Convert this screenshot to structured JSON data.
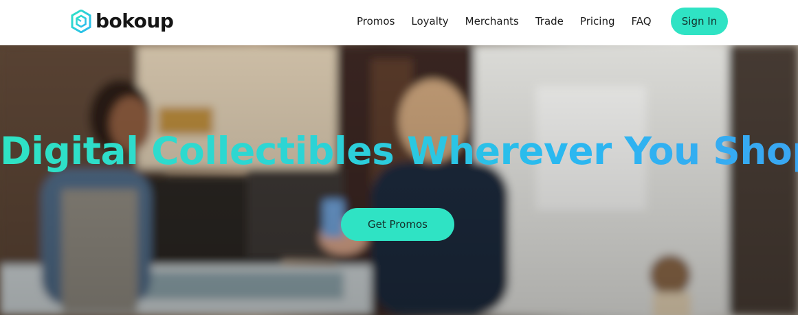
{
  "brand": {
    "name": "bokoup",
    "logo_icon": "hexagon-cube-icon"
  },
  "nav": {
    "items": [
      {
        "label": "Promos"
      },
      {
        "label": "Loyalty"
      },
      {
        "label": "Merchants"
      },
      {
        "label": "Trade"
      },
      {
        "label": "Pricing"
      },
      {
        "label": "FAQ"
      }
    ],
    "signin_label": "Sign In"
  },
  "hero": {
    "title": "Digital Collectibles Wherever You Shop",
    "cta_label": "Get Promos",
    "background": "blurred-coffee-shop-photo"
  },
  "colors": {
    "accent": "#2fe3c4",
    "gradient_end": "#3aa6f2",
    "nav_text": "#1c1c1c"
  }
}
